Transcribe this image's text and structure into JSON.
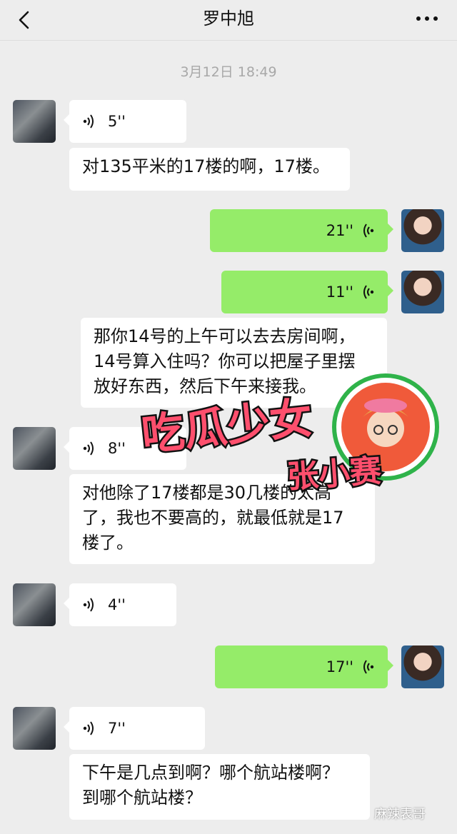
{
  "header": {
    "title": "罗中旭",
    "back_icon": "chevron-left-icon",
    "more_icon": "more-dots-icon"
  },
  "timestamp": "3月12日 18:49",
  "messages": [
    {
      "side": "in",
      "kind": "voice",
      "duration": "5''"
    },
    {
      "side": "in",
      "kind": "text",
      "text": "对135平米的17楼的啊，17楼。"
    },
    {
      "side": "out",
      "kind": "voice",
      "duration": "21''"
    },
    {
      "side": "out",
      "kind": "voice",
      "duration": "11''"
    },
    {
      "side": "in",
      "kind": "text",
      "text": "那你14号的上午可以去去房间啊，\n14号算入住吗？你可以把屋子里摆\n放好东西，然后下午来接我。"
    },
    {
      "side": "in",
      "kind": "voice",
      "duration": "8''"
    },
    {
      "side": "in",
      "kind": "text",
      "text": "对他除了17楼都是30几楼的太高\n了，我也不要高的，就最低就是17\n楼了。"
    },
    {
      "side": "in",
      "kind": "voice",
      "duration": "4''"
    },
    {
      "side": "out",
      "kind": "voice",
      "duration": "17''"
    },
    {
      "side": "in",
      "kind": "voice",
      "duration": "7''"
    },
    {
      "side": "in",
      "kind": "text",
      "text": "下午是几点到啊？哪个航站楼啊？\n到哪个航站楼？"
    }
  ],
  "watermark": {
    "line1": "吃瓜少女",
    "line2": "张小赛"
  },
  "corner_mark": "麻辣表哥",
  "colors": {
    "background": "#ededed",
    "incoming": "#ffffff",
    "outgoing": "#95ec69",
    "timestamp": "#a8a8a8"
  }
}
